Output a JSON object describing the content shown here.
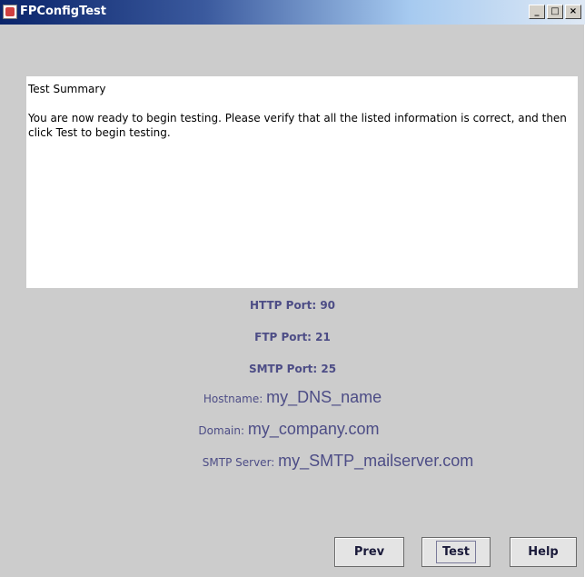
{
  "window": {
    "title": "FPConfigTest",
    "controls": {
      "minimize": "_",
      "maximize": "□",
      "close": "×"
    }
  },
  "summary": {
    "title": "Test Summary",
    "body": "You are now ready to begin testing.  Please verify that all the listed information is correct, and then click Test to begin testing."
  },
  "info": {
    "http_port": "HTTP Port: 90",
    "ftp_port": "FTP Port: 21",
    "smtp_port": "SMTP Port: 25",
    "hostname_label": "Hostname: ",
    "hostname_value": "my_DNS_name",
    "domain_label": "Domain: ",
    "domain_value": "my_company.com",
    "smtp_server_label": "SMTP Server: ",
    "smtp_server_value": "my_SMTP_mailserver.com"
  },
  "buttons": {
    "prev": "Prev",
    "test": "Test",
    "help": "Help"
  },
  "colors": {
    "info_text": "#4d4d86",
    "panel_bg": "#cccccc",
    "title_bar": "#0a246a"
  },
  "icons": {
    "app": "app-java-icon",
    "minimize": "minimize-icon",
    "maximize": "maximize-icon",
    "close": "close-icon"
  }
}
